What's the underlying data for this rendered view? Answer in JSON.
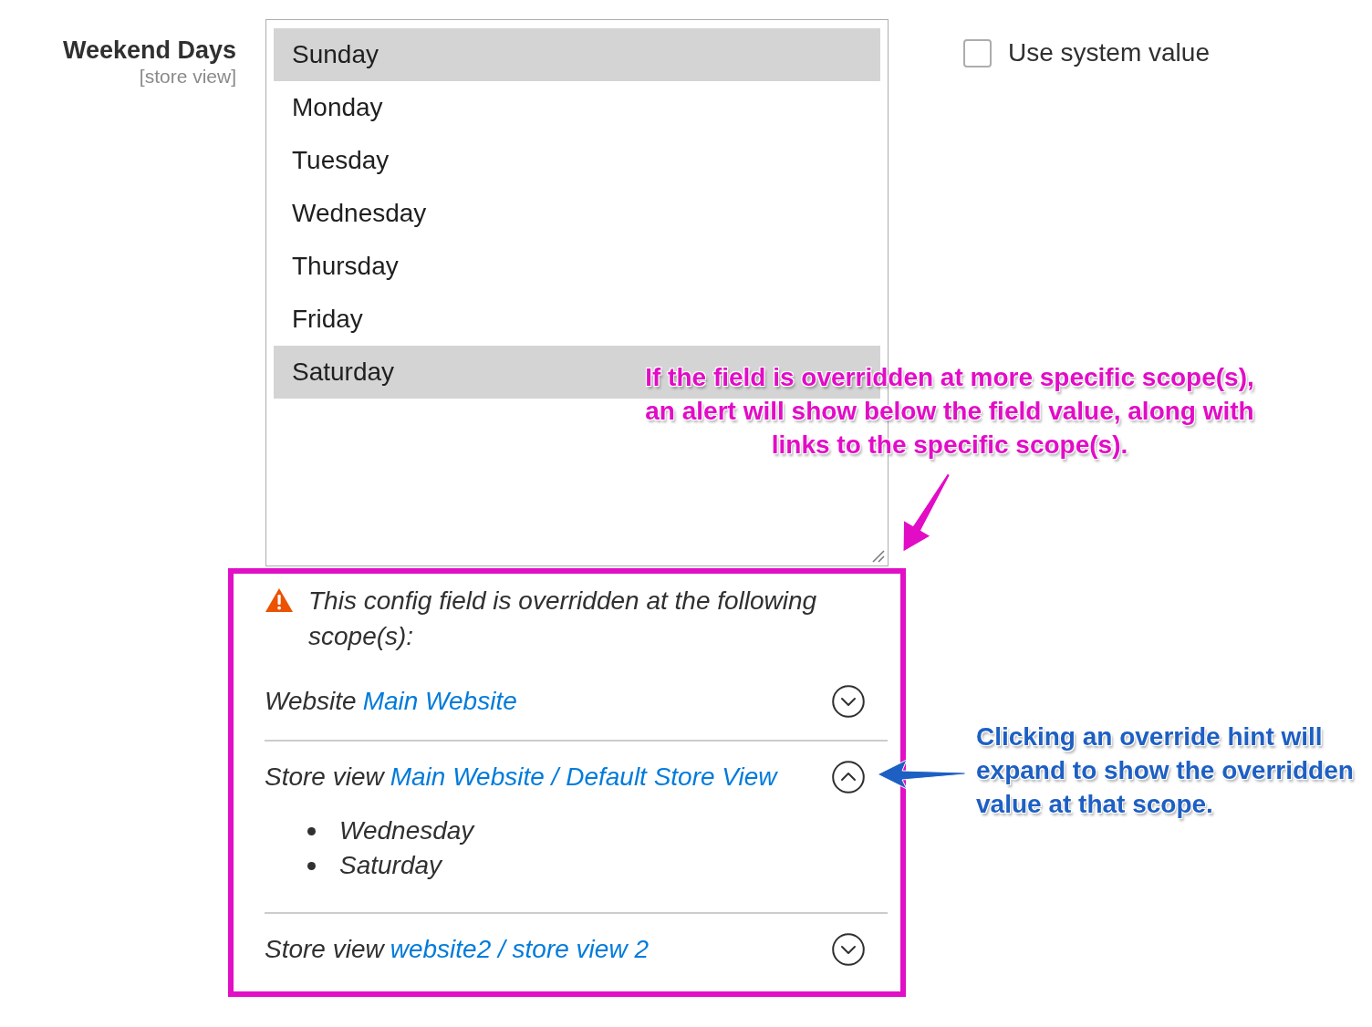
{
  "field": {
    "label": "Weekend Days",
    "scope": "[store view]"
  },
  "listbox": {
    "options": [
      {
        "label": "Sunday",
        "selected": true
      },
      {
        "label": "Monday",
        "selected": false
      },
      {
        "label": "Tuesday",
        "selected": false
      },
      {
        "label": "Wednesday",
        "selected": false
      },
      {
        "label": "Thursday",
        "selected": false
      },
      {
        "label": "Friday",
        "selected": false
      },
      {
        "label": "Saturday",
        "selected": true
      }
    ]
  },
  "use_system_value": {
    "label": "Use system value",
    "checked": false
  },
  "override_alert": {
    "message": "This config field is overridden at the following scope(s):",
    "scopes": [
      {
        "type": "Website",
        "link": "Main Website",
        "expanded": false
      },
      {
        "type": "Store view",
        "link": "Main Website / Default Store View",
        "expanded": true,
        "values": [
          "Wednesday",
          "Saturday"
        ]
      },
      {
        "type": "Store view",
        "link": "website2 / store view 2",
        "expanded": false
      }
    ]
  },
  "annotations": [
    {
      "text": "If the field is overridden at more specific scope(s), an alert will show below the field value, along with links to the specific scope(s).",
      "color": "#e20cc6"
    },
    {
      "text": "Clicking an override hint will expand to show the overridden value at that scope.",
      "color": "#1d5fc3"
    }
  ]
}
